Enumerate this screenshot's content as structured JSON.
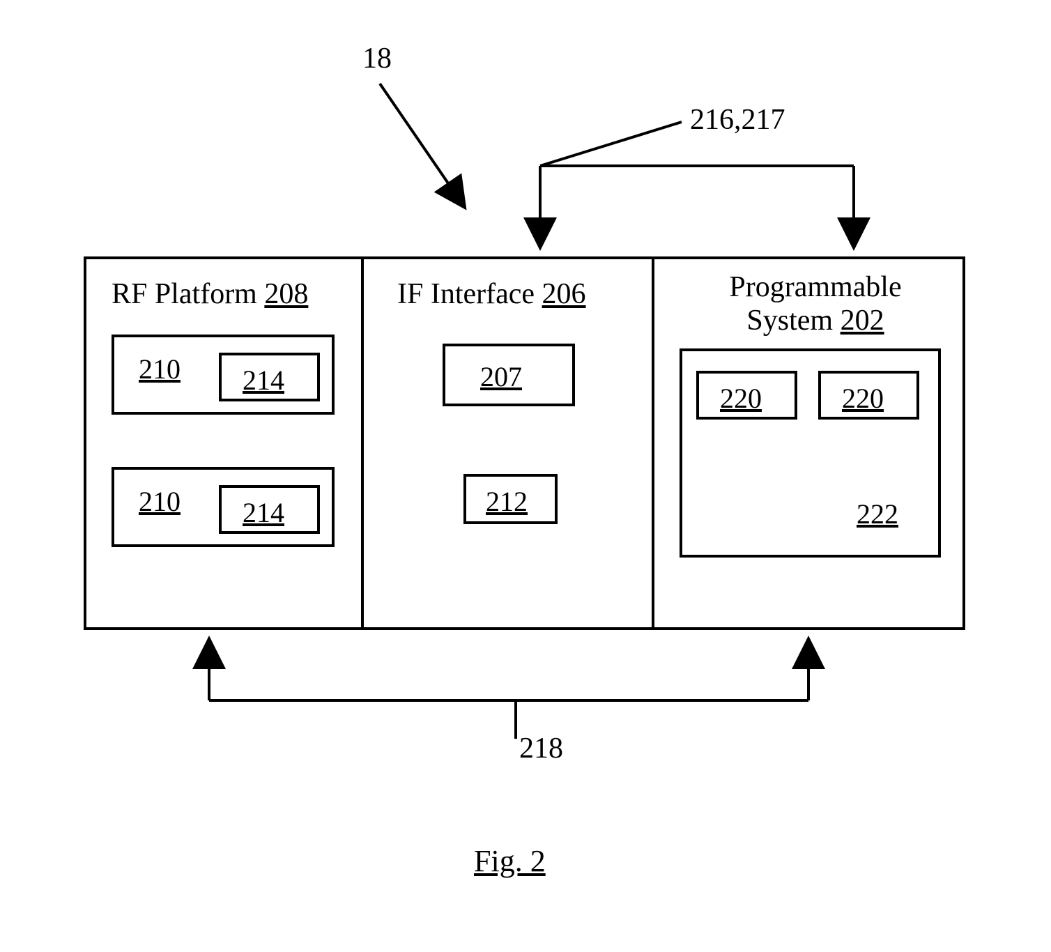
{
  "labels": {
    "top_ref": "18",
    "top_bracket_ref": "216,217",
    "bottom_ref": "218",
    "fig_caption": "Fig. 2"
  },
  "blocks": {
    "rf": {
      "title_prefix": "RF Platform ",
      "title_ref": "208",
      "box_a_ref": "210",
      "box_a_sub_ref": "214",
      "box_b_ref": "210",
      "box_b_sub_ref": "214"
    },
    "ifc": {
      "title_prefix": "IF Interface ",
      "title_ref": "206",
      "box_a_ref": "207",
      "box_b_ref": "212"
    },
    "prog": {
      "title_line1": "Programmable",
      "title_line2_prefix": "System ",
      "title_ref": "202",
      "sub_a_ref": "220",
      "sub_b_ref": "220",
      "sub_c_ref": "222"
    }
  }
}
